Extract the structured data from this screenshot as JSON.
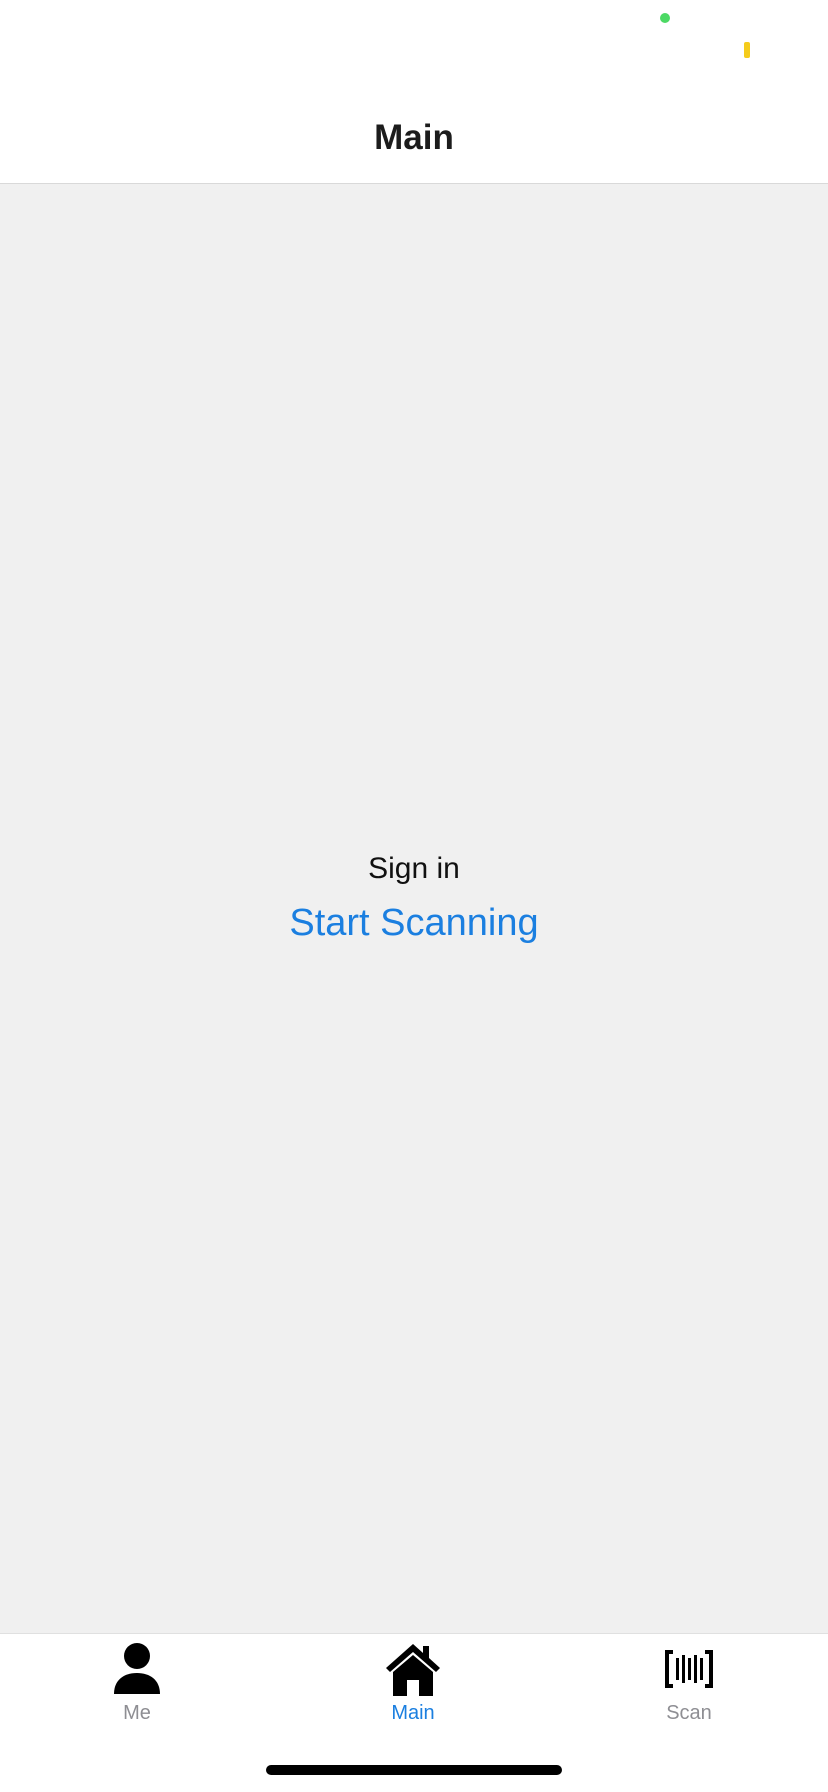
{
  "colors": {
    "privacy_dot": "#4cd964",
    "battery_mark": "#f5cc1c",
    "accent": "#1b7fe0",
    "inactive": "#8e8e93",
    "content_bg": "#f0f0f0"
  },
  "header": {
    "title": "Main"
  },
  "main": {
    "sign_in_label": "Sign in",
    "start_scanning_label": "Start Scanning"
  },
  "tab_bar": {
    "tabs": [
      {
        "label": "Me",
        "icon": "person-icon",
        "active": false
      },
      {
        "label": "Main",
        "icon": "home-icon",
        "active": true
      },
      {
        "label": "Scan",
        "icon": "barcode-icon",
        "active": false
      }
    ]
  }
}
